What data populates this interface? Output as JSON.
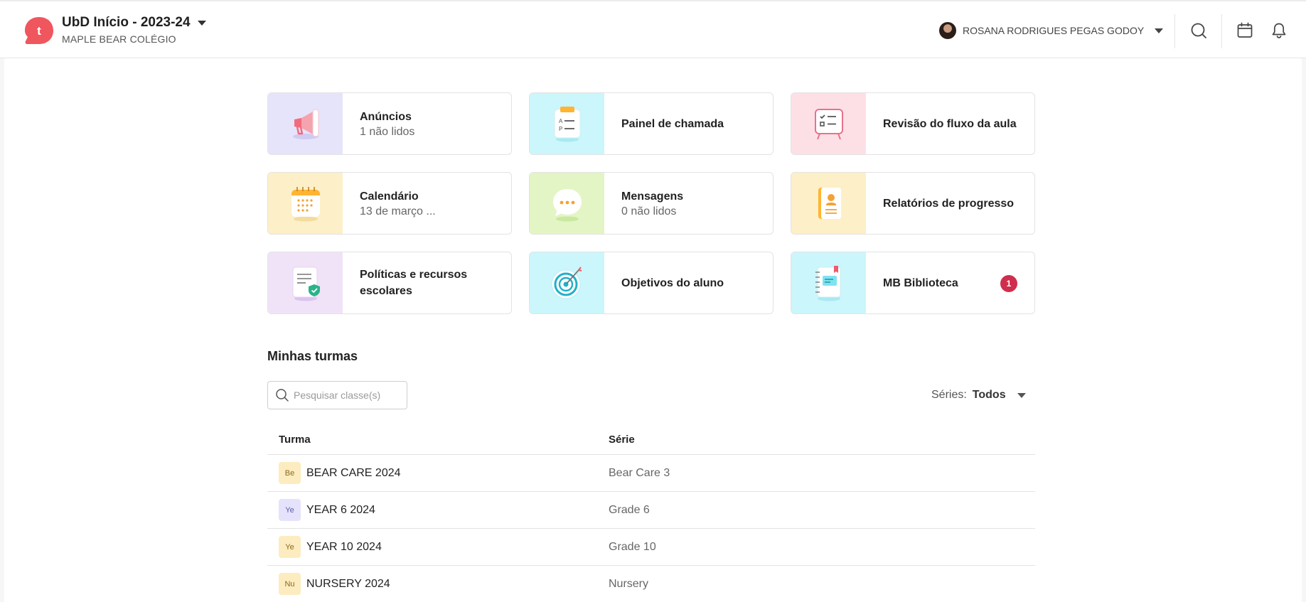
{
  "header": {
    "logo_letter": "t",
    "app_title": "UbD Início - 2023-24",
    "school_name": "MAPLE BEAR COLÉGIO",
    "user_name": "ROSANA RODRIGUES PEGAS GODOY",
    "icons": [
      "search-icon",
      "calendar-icon",
      "bell-icon"
    ]
  },
  "cards": [
    {
      "title": "Anúncios",
      "subtitle": "1 não lidos",
      "icon": "megaphone-icon",
      "color": "#e6e4fb"
    },
    {
      "title": "Painel de chamada",
      "subtitle": "",
      "icon": "attendance-clipboard-icon",
      "color": "#cbf6fb"
    },
    {
      "title": "Revisão do fluxo da aula",
      "subtitle": "",
      "icon": "checklist-board-icon",
      "color": "#fde0e6"
    },
    {
      "title": "Calendário",
      "subtitle": "13 de março ...",
      "icon": "calendar-illustration-icon",
      "color": "#fdefc7"
    },
    {
      "title": "Mensagens",
      "subtitle": "0 não lidos",
      "icon": "chat-bubble-icon",
      "color": "#e3f5c4"
    },
    {
      "title": "Relatórios de progresso",
      "subtitle": "",
      "icon": "report-book-icon",
      "color": "#fdefc7"
    },
    {
      "title": "Políticas e recursos escolares",
      "subtitle": "",
      "icon": "policy-document-icon",
      "color": "#f0e3f8"
    },
    {
      "title": "Objetivos do aluno",
      "subtitle": "",
      "icon": "target-icon",
      "color": "#cbf6fb"
    },
    {
      "title": "MB Biblioteca",
      "subtitle": "",
      "icon": "notebook-icon",
      "color": "#cbf6fb",
      "badge": "1"
    }
  ],
  "classes_section": {
    "title": "Minhas turmas",
    "search_placeholder": "Pesquisar classe(s)",
    "series_label": "Séries:",
    "series_value": "Todos",
    "columns": [
      "Turma",
      "Série"
    ],
    "rows": [
      {
        "tag": "Be",
        "name": "BEAR CARE 2024",
        "series": "Bear Care 3",
        "tag_color": "#fdecbf"
      },
      {
        "tag": "Ye",
        "name": "YEAR 6 2024",
        "series": "Grade 6",
        "tag_color": "#e5e3fb"
      },
      {
        "tag": "Ye",
        "name": "YEAR 10 2024",
        "series": "Grade 10",
        "tag_color": "#fdecbf"
      },
      {
        "tag": "Nu",
        "name": "NURSERY 2024",
        "series": "Nursery",
        "tag_color": "#fdecbf"
      }
    ]
  }
}
